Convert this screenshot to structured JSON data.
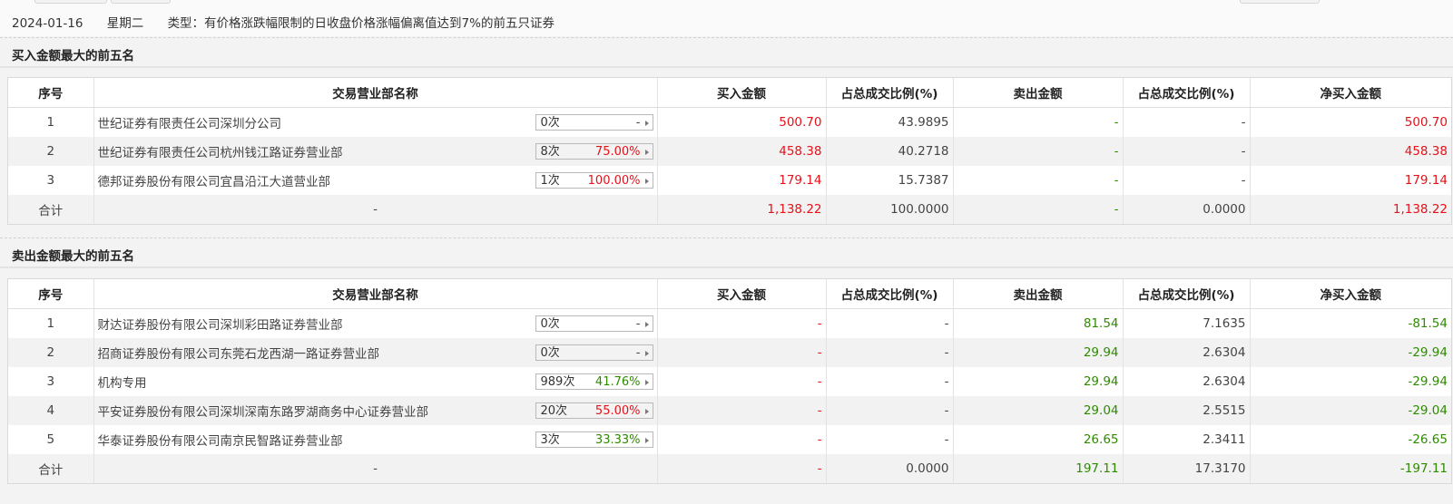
{
  "header": {
    "date": "2024-01-16",
    "weekday": "星期二",
    "type_text": "类型：有价格涨跌幅限制的日收盘价格涨幅偏离值达到7%的前五只证券"
  },
  "columns": [
    "序号",
    "交易营业部名称",
    "买入金额",
    "占总成交比例(%)",
    "卖出金额",
    "占总成交比例(%)",
    "净买入金额"
  ],
  "buy_section": {
    "title": "买入金额最大的前五名",
    "rows": [
      {
        "no": "1",
        "name": "世纪证券有限责任公司深圳分公司",
        "count": "0次",
        "pct": "-",
        "buy": "500.70",
        "buy_ratio": "43.9895",
        "sell": "-",
        "sell_ratio": "-",
        "net": "500.70"
      },
      {
        "no": "2",
        "name": "世纪证券有限责任公司杭州钱江路证券营业部",
        "count": "8次",
        "pct": "75.00%",
        "buy": "458.38",
        "buy_ratio": "40.2718",
        "sell": "-",
        "sell_ratio": "-",
        "net": "458.38"
      },
      {
        "no": "3",
        "name": "德邦证券股份有限公司宜昌沿江大道营业部",
        "count": "1次",
        "pct": "100.00%",
        "buy": "179.14",
        "buy_ratio": "15.7387",
        "sell": "-",
        "sell_ratio": "-",
        "net": "179.14"
      }
    ],
    "total": {
      "label": "合计",
      "name": "-",
      "buy": "1,138.22",
      "buy_ratio": "100.0000",
      "sell": "-",
      "sell_ratio": "0.0000",
      "net": "1,138.22"
    }
  },
  "sell_section": {
    "title": "卖出金额最大的前五名",
    "rows": [
      {
        "no": "1",
        "name": "财达证券股份有限公司深圳彩田路证券营业部",
        "count": "0次",
        "pct": "-",
        "buy": "-",
        "buy_ratio": "-",
        "sell": "81.54",
        "sell_ratio": "7.1635",
        "net": "-81.54"
      },
      {
        "no": "2",
        "name": "招商证券股份有限公司东莞石龙西湖一路证券营业部",
        "count": "0次",
        "pct": "-",
        "buy": "-",
        "buy_ratio": "-",
        "sell": "29.94",
        "sell_ratio": "2.6304",
        "net": "-29.94"
      },
      {
        "no": "3",
        "name": "机构专用",
        "count": "989次",
        "pct": "41.76%",
        "buy": "-",
        "buy_ratio": "-",
        "sell": "29.94",
        "sell_ratio": "2.6304",
        "net": "-29.94"
      },
      {
        "no": "4",
        "name": "平安证券股份有限公司深圳深南东路罗湖商务中心证券营业部",
        "count": "20次",
        "pct": "55.00%",
        "buy": "-",
        "buy_ratio": "-",
        "sell": "29.04",
        "sell_ratio": "2.5515",
        "net": "-29.04"
      },
      {
        "no": "5",
        "name": "华泰证券股份有限公司南京民智路证券营业部",
        "count": "3次",
        "pct": "33.33%",
        "buy": "-",
        "buy_ratio": "-",
        "sell": "26.65",
        "sell_ratio": "2.3411",
        "net": "-26.65"
      }
    ],
    "total": {
      "label": "合计",
      "name": "-",
      "buy": "-",
      "buy_ratio": "0.0000",
      "sell": "197.11",
      "sell_ratio": "17.3170",
      "net": "-197.11"
    }
  },
  "colors": {
    "up": "#e5121a",
    "down": "#2e8b00",
    "text": "#333333"
  }
}
